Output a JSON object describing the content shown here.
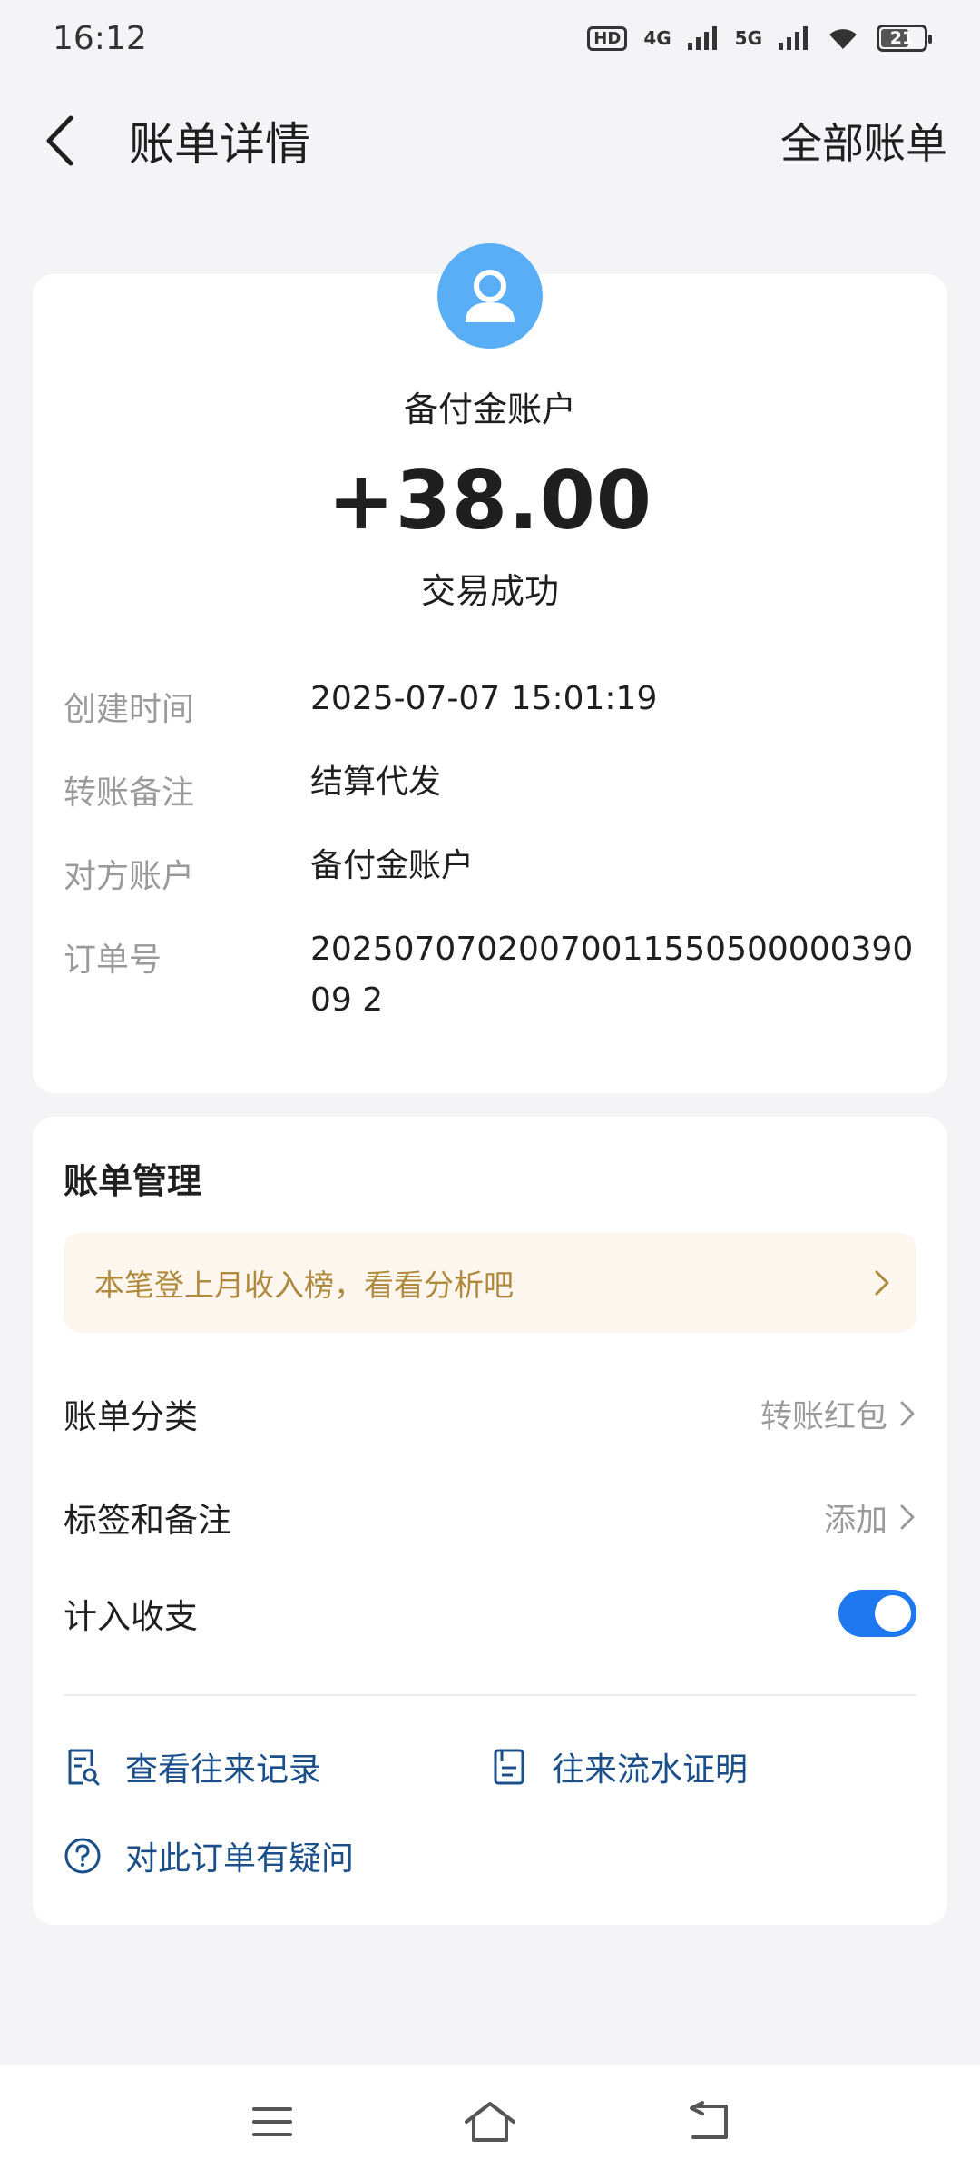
{
  "status_bar": {
    "time": "16:12",
    "hd_label": "HD",
    "network1": "4G",
    "network2": "5G",
    "battery": "21"
  },
  "nav": {
    "title": "账单详情",
    "right_link": "全部账单"
  },
  "transaction": {
    "counterparty": "备付金账户",
    "amount": "+38.00",
    "status": "交易成功",
    "details": [
      {
        "label": "创建时间",
        "value": "2025-07-07 15:01:19"
      },
      {
        "label": "转账备注",
        "value": "结算代发"
      },
      {
        "label": "对方账户",
        "value": "备付金账户"
      },
      {
        "label": "订单号",
        "value": "2025070702007001155050000039009 2"
      }
    ]
  },
  "management": {
    "title": "账单管理",
    "banner": "本笔登上月收入榜，看看分析吧",
    "category_label": "账单分类",
    "category_value": "转账红包",
    "tag_label": "标签和备注",
    "tag_value": "添加",
    "count_label": "计入收支",
    "count_enabled": true,
    "links": {
      "records": "查看往来记录",
      "proof": "往来流水证明",
      "question": "对此订单有疑问"
    }
  },
  "colors": {
    "accent": "#1e78f0",
    "avatar": "#5aaef5",
    "link": "#1a4f8a",
    "banner_text": "#b08a3c"
  }
}
